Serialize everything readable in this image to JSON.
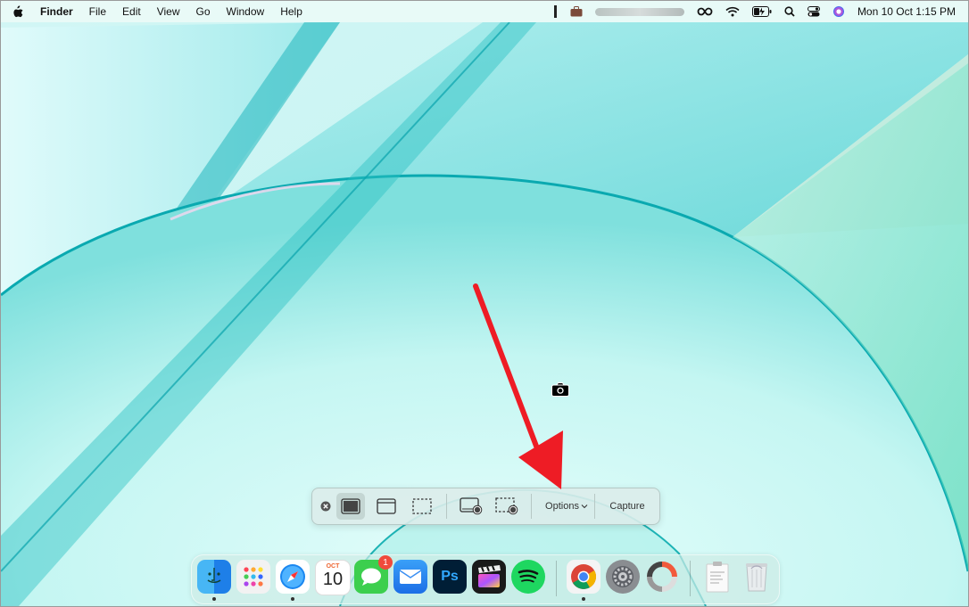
{
  "menubar": {
    "app_name": "Finder",
    "menus": [
      "File",
      "Edit",
      "View",
      "Go",
      "Window",
      "Help"
    ],
    "icons": [
      "apple-logo",
      "screen-recording-indicator",
      "briefcase-icon",
      "infinity-icon",
      "wifi-icon",
      "battery-charging-icon",
      "search-icon",
      "control-center-icon",
      "siri-icon"
    ],
    "clock": "Mon 10 Oct  1:15 PM"
  },
  "screenshot_toolbar": {
    "buttons": [
      "close",
      "capture-entire-screen",
      "capture-selected-window",
      "capture-selected-portion",
      "record-entire-screen",
      "record-selected-portion"
    ],
    "active_button": "capture-entire-screen",
    "options_label": "Options",
    "capture_label": "Capture"
  },
  "dock": {
    "apps": [
      "Finder",
      "Launchpad",
      "Safari",
      "Calendar",
      "Messages",
      "Mail",
      "Photoshop",
      "Final Cut Pro",
      "Spotify",
      "Chrome",
      "System Preferences",
      "Disk Diag",
      "Notes Document",
      "Trash"
    ],
    "calendar_month": "OCT",
    "calendar_day": "10",
    "messages_badge": "1",
    "photoshop_label": "Ps"
  },
  "annotation": {
    "arrow_color": "#ee1c25",
    "camera_cursor": "camera-icon"
  },
  "colors": {
    "wallpaper_light": "#d8fbf8",
    "wallpaper_teal": "#19b8c0",
    "accent": "#ee1c25"
  }
}
